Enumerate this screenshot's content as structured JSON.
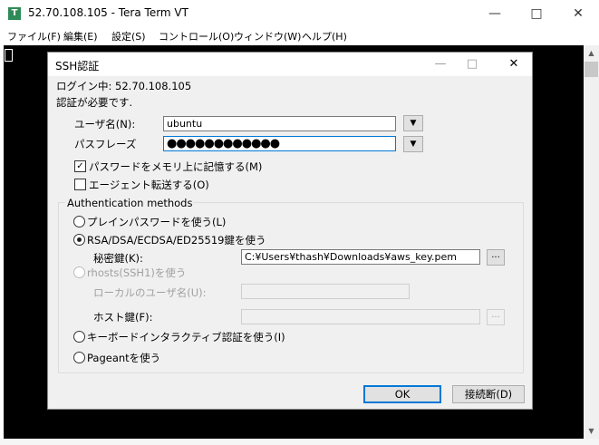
{
  "window": {
    "title": "52.70.108.105 - Tera Term VT",
    "icon_glyph": "T",
    "minimize": "—",
    "maximize": "□",
    "close": "✕"
  },
  "menu": [
    "ファイル(F)",
    "編集(E)",
    "設定(S)",
    "コントロール(O)",
    "ウィンドウ(W)",
    "ヘルプ(H)"
  ],
  "dialog": {
    "title": "SSH認証",
    "minimize": "—",
    "maximize": "□",
    "close": "✕",
    "login_status": "ログイン中: 52.70.108.105",
    "auth_required": "認証が必要です.",
    "username_label": "ユーザ名(N):",
    "username_value": "ubuntu",
    "passphrase_label": "パスフレーズ",
    "passphrase_value": "●●●●●●●●●●●●",
    "remember_password_label": "パスワードをメモリ上に記憶する(M)",
    "remember_password_checked": true,
    "agent_forward_label": "エージェント転送する(O)",
    "agent_forward_checked": false,
    "auth_methods_label": "Authentication methods",
    "plain_password_label": "プレインパスワードを使う(L)",
    "rsa_label": "RSA/DSA/ECDSA/ED25519鍵を使う",
    "private_key_label": "秘密鍵(K):",
    "private_key_value": "C:¥Users¥thash¥Downloads¥aws_key.pem",
    "browse_label": "...",
    "rhosts_label": "rhosts(SSH1)を使う",
    "local_user_label": "ローカルのユーザ名(U):",
    "local_user_value": "",
    "host_key_label": "ホスト鍵(F):",
    "host_key_value": "",
    "keyboard_interactive_label": "キーボードインタラクティブ認証を使う(I)",
    "pageant_label": "Pageantを使う",
    "selected_method": "rsa",
    "ok_label": "OK",
    "disconnect_label": "接続断(D)",
    "dropdown_glyph": "▼",
    "check_glyph": "✓"
  },
  "scrollbar": {
    "up": "▲",
    "down": "▼"
  }
}
